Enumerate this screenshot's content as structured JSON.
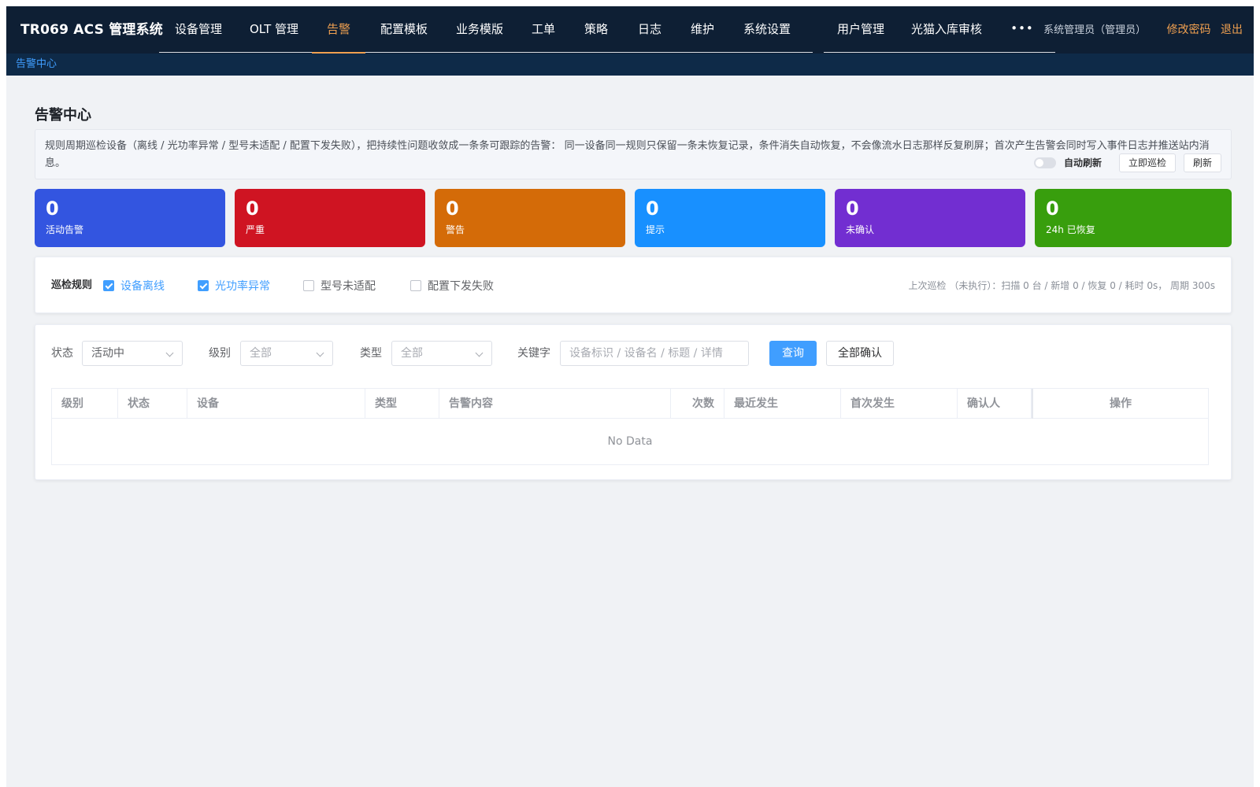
{
  "app": {
    "title": "TR069 ACS 管理系统"
  },
  "nav": {
    "items": [
      "设备管理",
      "OLT 管理",
      "告警",
      "配置模板",
      "业务模版",
      "工单",
      "策略",
      "日志",
      "维护",
      "系统设置"
    ],
    "items2": [
      "用户管理",
      "光猫入库审核"
    ],
    "active": "告警",
    "more": "•••"
  },
  "user": {
    "name": "系统管理员（管理员）",
    "change_password": "修改密码",
    "logout": "退出"
  },
  "breadcrumb": {
    "current": "告警中心"
  },
  "page": {
    "title": "告警中心",
    "description": "规则周期巡检设备（离线 / 光功率异常 / 型号未适配 / 配置下发失败），把持续性问题收敛成一条条可跟踪的告警： 同一设备同一规则只保留一条未恢复记录，条件消失自动恢复，不会像流水日志那样反复刷屏；首次产生告警会同时写入事件日志并推送站内消息。",
    "auto_refresh_label": "自动刷新",
    "auto_refresh_on": false,
    "inspect_now": "立即巡检",
    "refresh": "刷新"
  },
  "stats": [
    {
      "value": "0",
      "label": "活动告警",
      "color": "#3355e0"
    },
    {
      "value": "0",
      "label": "严重",
      "color": "#cf1422"
    },
    {
      "value": "0",
      "label": "警告",
      "color": "#d46b08"
    },
    {
      "value": "0",
      "label": "提示",
      "color": "#1890ff"
    },
    {
      "value": "0",
      "label": "未确认",
      "color": "#722ed1"
    },
    {
      "value": "0",
      "label": "24h 已恢复",
      "color": "#389e0d"
    }
  ],
  "rules": {
    "title": "巡检规则",
    "items": [
      {
        "label": "设备离线",
        "checked": true
      },
      {
        "label": "光功率异常",
        "checked": true
      },
      {
        "label": "型号未适配",
        "checked": false
      },
      {
        "label": "配置下发失败",
        "checked": false
      }
    ],
    "status": "上次巡检 （未执行）：扫描 0 台 / 新增 0 / 恢复 0 / 耗时 0s， 周期 300s"
  },
  "filters": {
    "status_label": "状态",
    "status_value": "活动中",
    "level_label": "级别",
    "level_placeholder": "全部",
    "type_label": "类型",
    "type_placeholder": "全部",
    "keyword_label": "关键字",
    "keyword_placeholder": "设备标识 / 设备名 / 标题 / 详情",
    "keyword_value": "",
    "query": "查询",
    "ack_all": "全部确认"
  },
  "table": {
    "columns": [
      "级别",
      "状态",
      "设备",
      "类型",
      "告警内容",
      "次数",
      "最近发生",
      "首次发生",
      "确认人",
      "操作"
    ],
    "rows": [],
    "empty_text": "No Data"
  },
  "colors": {
    "navbar": "#0e1f34",
    "accent": "#f0a050",
    "primary": "#409eff"
  }
}
